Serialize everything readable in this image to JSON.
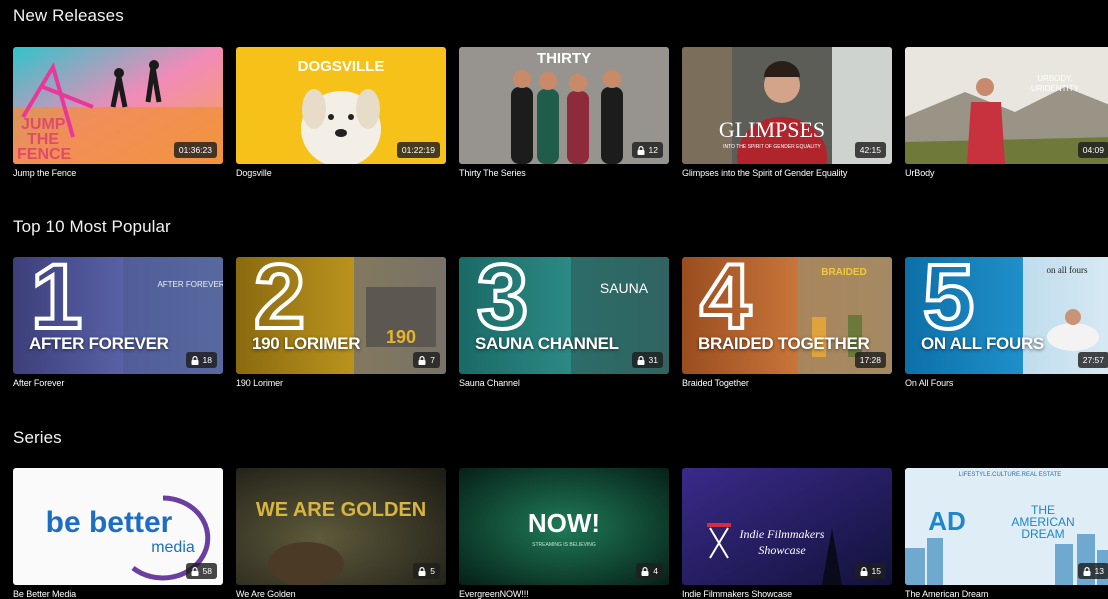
{
  "rows": [
    {
      "title": "New Releases",
      "items": [
        {
          "title": "Jump the Fence",
          "badge": "01:36:23",
          "badge_type": "duration",
          "art_text": "JUMP THE FENCE"
        },
        {
          "title": "Dogsville",
          "badge": "01:22:19",
          "badge_type": "duration",
          "art_text": "DOGSVILLE"
        },
        {
          "title": "Thirty The Series",
          "badge": "12",
          "badge_type": "episodes",
          "art_text": "THIRTY"
        },
        {
          "title": "Glimpses into the Spirit of Gender Equality",
          "badge": "42:15",
          "badge_type": "duration",
          "art_text": "GLIMPSES",
          "art_sub": "INTO THE SPIRIT OF GENDER EQUALITY"
        },
        {
          "title": "UrBody",
          "badge": "04:09",
          "badge_type": "duration",
          "art_text": "URBODY, URIDENTITY"
        }
      ]
    },
    {
      "title": "Top 10 Most Popular",
      "items": [
        {
          "title": "After Forever",
          "badge": "18",
          "badge_type": "episodes",
          "rank": "1",
          "art_text": "AFTER FOREVER",
          "art_sub": "AFTER FOREVER"
        },
        {
          "title": "190 Lorimer",
          "badge": "7",
          "badge_type": "episodes",
          "rank": "2",
          "art_text": "190 LORIMER",
          "art_sub": "190 LORIMER"
        },
        {
          "title": "Sauna Channel",
          "badge": "31",
          "badge_type": "episodes",
          "rank": "3",
          "art_text": "SAUNA CHANNEL",
          "art_sub": "SAUNA CHANNEL"
        },
        {
          "title": "Braided Together",
          "badge": "17:28",
          "badge_type": "duration",
          "rank": "4",
          "art_text": "BRAIDED TOGETHER",
          "art_sub": "BRAIDED TOGETHER"
        },
        {
          "title": "On All Fours",
          "badge": "27:57",
          "badge_type": "duration",
          "rank": "5",
          "art_text": "ON ALL FOURS",
          "art_sub": "on all fours"
        }
      ]
    },
    {
      "title": "Series",
      "items": [
        {
          "title": "Be Better Media",
          "badge": "58",
          "badge_type": "episodes",
          "art_text": "be better",
          "art_sub": "media"
        },
        {
          "title": "We Are Golden",
          "badge": "5",
          "badge_type": "episodes",
          "art_text": "WE ARE GOLDEN"
        },
        {
          "title": "EvergreenNOW!!!",
          "badge": "4",
          "badge_type": "episodes",
          "art_text": "NOW!",
          "art_sub": "STREAMING IS BELIEVING"
        },
        {
          "title": "Indie Filmmakers Showcase",
          "badge": "15",
          "badge_type": "episodes",
          "art_text": "Indie Filmmakers Showcase"
        },
        {
          "title": "The American Dream",
          "badge": "13",
          "badge_type": "episodes",
          "art_text": "THE AMERICAN DREAM",
          "art_sub": "LIFESTYLE.CULTURE.REAL ESTATE"
        }
      ]
    }
  ],
  "colors": {
    "background": "#000000",
    "badge_bg": "#1e1e1e",
    "text": "#ffffff"
  }
}
